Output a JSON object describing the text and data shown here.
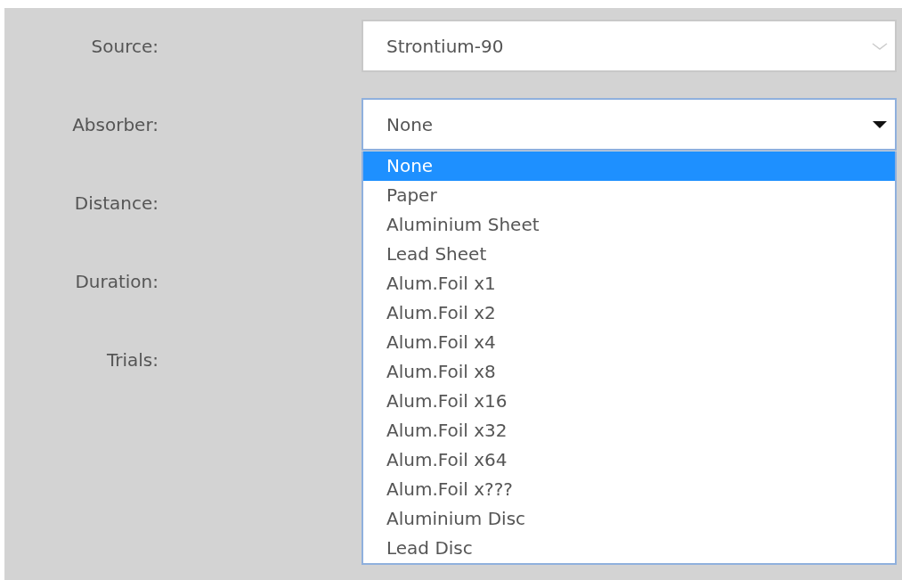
{
  "fields": [
    {
      "label": "Source:",
      "kind": "select",
      "value": "Strontium-90",
      "focused": false
    },
    {
      "label": "Absorber:",
      "kind": "select",
      "value": "None",
      "focused": true,
      "options": [
        {
          "label": "None",
          "selected": true
        },
        {
          "label": "Paper",
          "selected": false
        },
        {
          "label": "Aluminium Sheet",
          "selected": false
        },
        {
          "label": "Lead Sheet",
          "selected": false
        },
        {
          "label": "Alum.Foil x1",
          "selected": false
        },
        {
          "label": "Alum.Foil x2",
          "selected": false
        },
        {
          "label": "Alum.Foil x4",
          "selected": false
        },
        {
          "label": "Alum.Foil x8",
          "selected": false
        },
        {
          "label": "Alum.Foil x16",
          "selected": false
        },
        {
          "label": "Alum.Foil x32",
          "selected": false
        },
        {
          "label": "Alum.Foil x64",
          "selected": false
        },
        {
          "label": "Alum.Foil x???",
          "selected": false
        },
        {
          "label": "Aluminium Disc",
          "selected": false
        },
        {
          "label": "Lead Disc",
          "selected": false
        }
      ]
    },
    {
      "label": "Distance:",
      "kind": "hidden"
    },
    {
      "label": "Duration:",
      "kind": "hidden"
    },
    {
      "label": "Trials:",
      "kind": "hidden"
    }
  ]
}
